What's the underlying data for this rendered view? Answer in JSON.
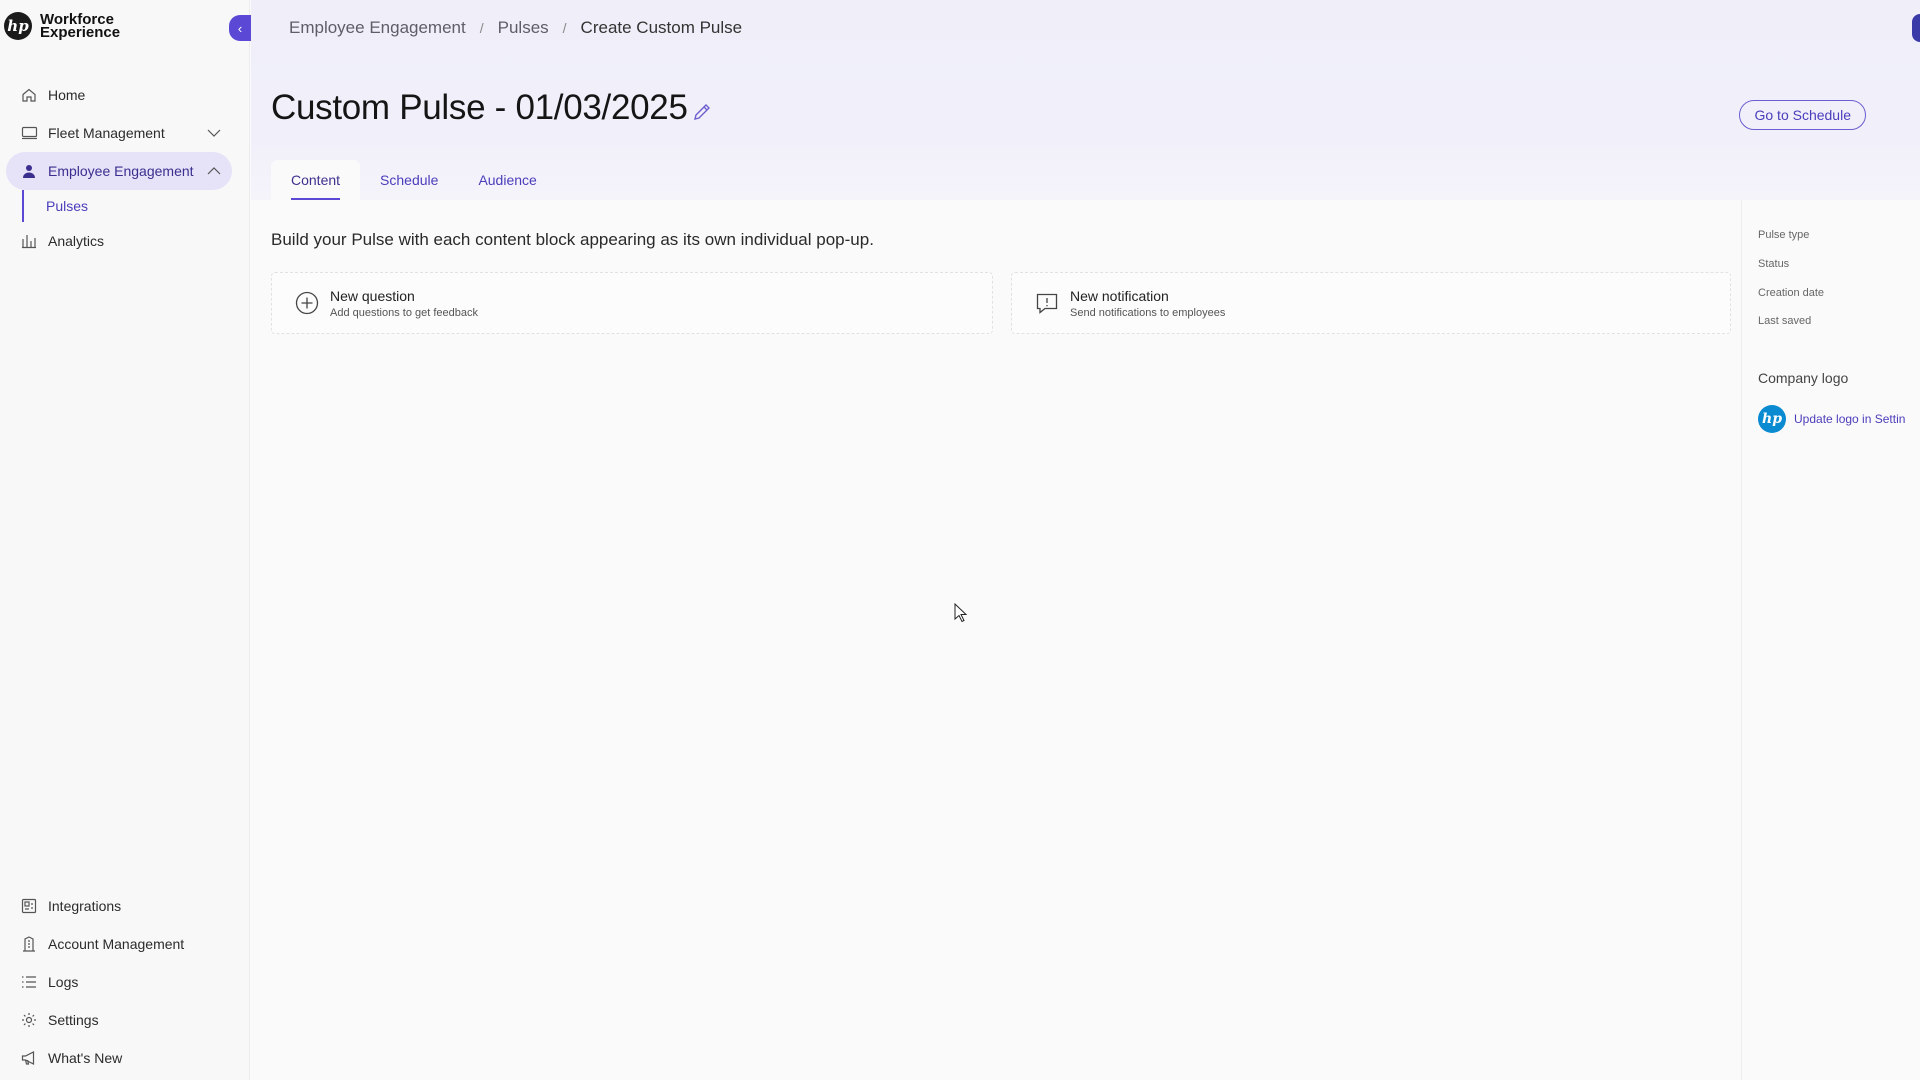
{
  "app": {
    "brand_line1": "Workforce",
    "brand_line2": "Experience",
    "logo_text": "hp"
  },
  "sidebar": {
    "top_items": [
      {
        "label": "Home",
        "icon": "home-icon"
      },
      {
        "label": "Fleet Management",
        "icon": "monitor-icon",
        "expanded": false
      },
      {
        "label": "Employee Engagement",
        "icon": "person-icon",
        "expanded": true,
        "active": true
      },
      {
        "label": "Pulses",
        "sub": true
      },
      {
        "label": "Analytics",
        "icon": "bar-chart-icon"
      }
    ],
    "bottom_items": [
      {
        "label": "Integrations",
        "icon": "integrations-icon"
      },
      {
        "label": "Account Management",
        "icon": "building-icon"
      },
      {
        "label": "Logs",
        "icon": "list-icon"
      },
      {
        "label": "Settings",
        "icon": "gear-icon"
      },
      {
        "label": "What's New",
        "icon": "megaphone-icon"
      }
    ]
  },
  "breadcrumb": [
    {
      "label": "Employee Engagement"
    },
    {
      "label": "Pulses"
    },
    {
      "label": "Create Custom Pulse"
    }
  ],
  "breadcrumb_separator": "/",
  "page": {
    "title": "Custom Pulse - 01/03/2025",
    "go_to_schedule": "Go to Schedule",
    "tabs": [
      {
        "label": "Content",
        "active": true
      },
      {
        "label": "Schedule",
        "active": false
      },
      {
        "label": "Audience",
        "active": false
      }
    ],
    "intro": "Build your Pulse with each content block appearing as its own individual pop-up.",
    "blocks": [
      {
        "title": "New question",
        "subtitle": "Add questions to get feedback",
        "icon": "plus-circle-icon"
      },
      {
        "title": "New notification",
        "subtitle": "Send notifications to employees",
        "icon": "notification-icon"
      }
    ]
  },
  "details": {
    "labels": [
      "Pulse type",
      "Status",
      "Creation date",
      "Last saved"
    ],
    "company_logo_label": "Company logo",
    "company_logo_text": "hp",
    "update_logo_link": "Update logo in Settin"
  },
  "colors": {
    "accent": "#5b49d6",
    "active_nav_bg": "#e6e2f8",
    "header_bg": "#f0eff9",
    "link": "#4a3dbb"
  }
}
